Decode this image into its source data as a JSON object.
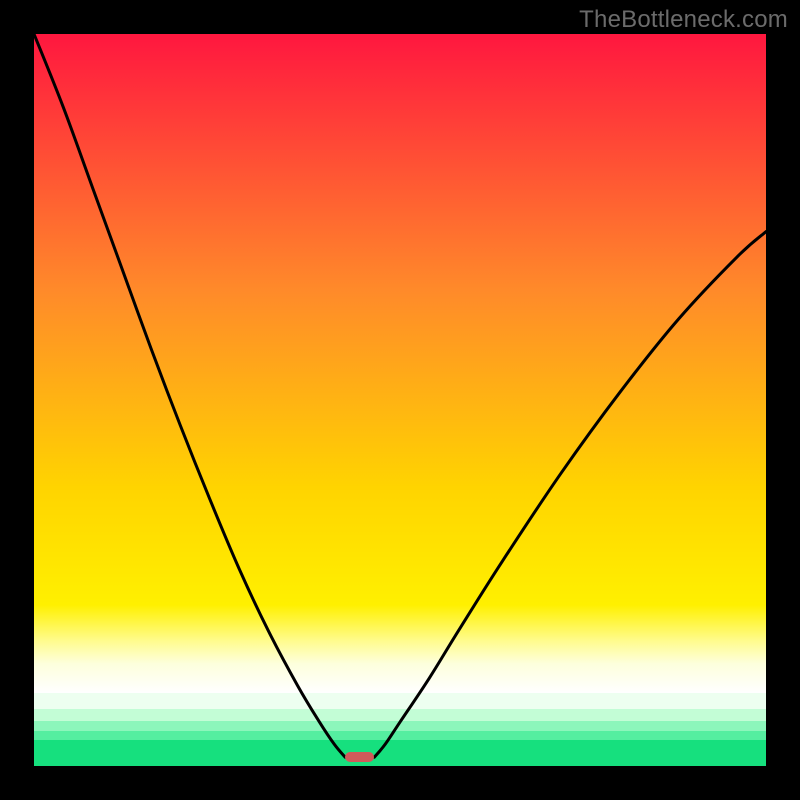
{
  "watermark": {
    "text": "TheBottleneck.com"
  },
  "chart_data": {
    "type": "line",
    "title": "",
    "xlabel": "",
    "ylabel": "",
    "xlim": [
      0,
      100
    ],
    "ylim": [
      0,
      100
    ],
    "grid": false,
    "legend": false,
    "series": [
      {
        "name": "left-branch",
        "x": [
          0,
          4,
          8,
          12,
          16,
          20,
          24,
          28,
          32,
          36,
          39,
          41,
          42.5
        ],
        "y": [
          100,
          90,
          79,
          68,
          57,
          46.5,
          36.5,
          27,
          18.5,
          11,
          6,
          3,
          1.2
        ]
      },
      {
        "name": "right-branch",
        "x": [
          46.5,
          48,
          50,
          54,
          58,
          64,
          72,
          80,
          88,
          96,
          100
        ],
        "y": [
          1.2,
          3,
          6,
          12,
          18.5,
          28,
          40,
          51,
          61,
          69.5,
          73
        ]
      }
    ],
    "dip_marker": {
      "x_left": 42.5,
      "x_right": 46.5,
      "y": 1.2,
      "color": "#d05a5a"
    },
    "background_gradient": {
      "stops": [
        {
          "pos": 0.0,
          "color": "#ff173f"
        },
        {
          "pos": 0.35,
          "color": "#ff8a2a"
        },
        {
          "pos": 0.62,
          "color": "#ffd400"
        },
        {
          "pos": 0.78,
          "color": "#fff000"
        },
        {
          "pos": 0.83,
          "color": "#fffc90"
        },
        {
          "pos": 0.86,
          "color": "#fdffdc"
        },
        {
          "pos": 0.9,
          "color": "#ffffff"
        }
      ]
    },
    "bottom_bands": [
      {
        "top_pct": 90.0,
        "height_pct": 2.2,
        "color": "#edfff0"
      },
      {
        "top_pct": 92.2,
        "height_pct": 1.6,
        "color": "#c3fdd6"
      },
      {
        "top_pct": 93.8,
        "height_pct": 1.4,
        "color": "#8cf6bb"
      },
      {
        "top_pct": 95.2,
        "height_pct": 1.2,
        "color": "#55eea0"
      },
      {
        "top_pct": 96.4,
        "height_pct": 3.6,
        "color": "#16e07e"
      }
    ],
    "annotations": []
  }
}
